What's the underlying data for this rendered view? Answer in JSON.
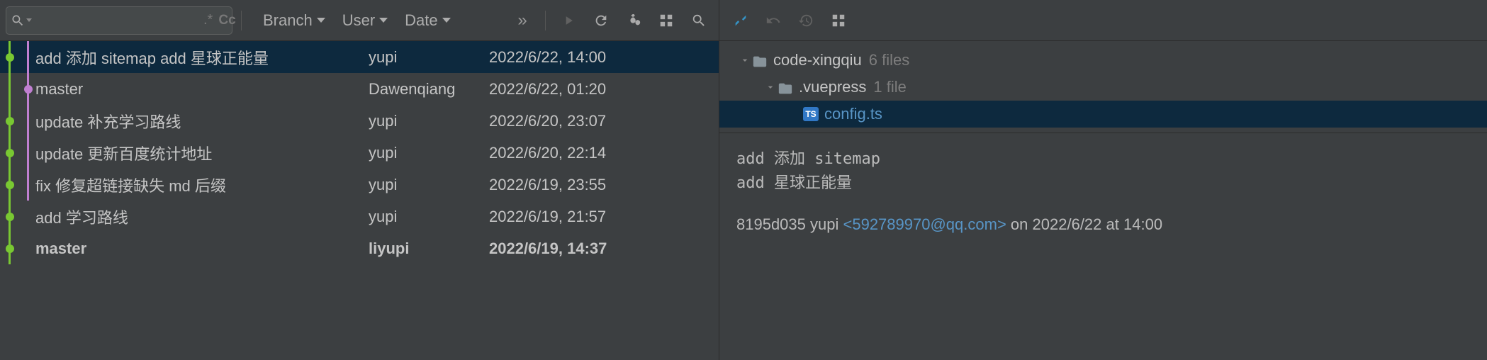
{
  "filters": {
    "branch": "Branch",
    "user": "User",
    "date": "Date"
  },
  "search": {
    "regex_label": ".*",
    "cc_label": "Cc"
  },
  "commits": [
    {
      "message": "add 添加 sitemap add 星球正能量",
      "author": "yupi",
      "date": "2022/6/22, 14:00",
      "selected": true,
      "bold": false,
      "lane": 0,
      "l1": true
    },
    {
      "message": "master",
      "author": "Dawenqiang",
      "date": "2022/6/22, 01:20",
      "selected": false,
      "bold": false,
      "lane": 1,
      "l1": true,
      "merge": true
    },
    {
      "message": "update 补充学习路线",
      "author": "yupi",
      "date": "2022/6/20, 23:07",
      "selected": false,
      "bold": false,
      "lane": 0,
      "l1": true
    },
    {
      "message": "update 更新百度统计地址",
      "author": "yupi",
      "date": "2022/6/20, 22:14",
      "selected": false,
      "bold": false,
      "lane": 0,
      "l1": true
    },
    {
      "message": "fix 修复超链接缺失 md 后缀",
      "author": "yupi",
      "date": "2022/6/19, 23:55",
      "selected": false,
      "bold": false,
      "lane": 0,
      "l1": true
    },
    {
      "message": "add 学习路线",
      "author": "yupi",
      "date": "2022/6/19, 21:57",
      "selected": false,
      "bold": false,
      "lane": 0,
      "l1": false
    },
    {
      "message": "master",
      "author": "liyupi",
      "date": "2022/6/19, 14:37",
      "selected": false,
      "bold": true,
      "lane": 0,
      "l1": false
    }
  ],
  "file_tree": {
    "root": {
      "name": "code-xingqiu",
      "meta": "6 files"
    },
    "child1": {
      "name": ".vuepress",
      "meta": "1 file"
    },
    "child2": {
      "name": "config.ts",
      "badge": "TS"
    }
  },
  "commit_detail": {
    "msg_line1": "add 添加 sitemap",
    "msg_line2": "add 星球正能量",
    "hash": "8195d035",
    "author_name": "yupi",
    "email": "<592789970@qq.com>",
    "on_word": "on",
    "at_word": "at",
    "date": "2022/6/22",
    "time": "14:00"
  }
}
